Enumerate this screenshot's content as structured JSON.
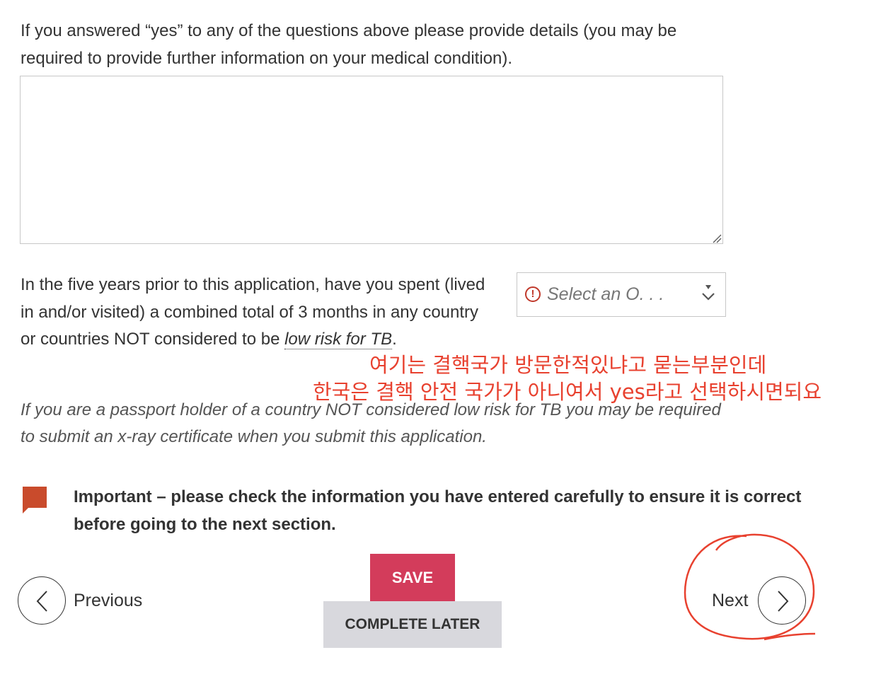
{
  "question_details": {
    "text": "If you answered “yes” to any of the questions above please provide details (you may be required to provide further information on your medical condition).",
    "value": ""
  },
  "question_tb": {
    "text_before": "In the five years prior to this application, have you spent (lived in and/or visited) a combined total of 3 months in any country or countries NOT considered to be ",
    "term": "low risk for TB",
    "text_after": ".",
    "select_placeholder": "Select an O. . .",
    "warning_icon": "!",
    "note": "If you are a passport holder of a country NOT considered low risk for TB you may be required to submit an x-ray certificate when you submit this application."
  },
  "annotation": {
    "line1": "여기는 결핵국가 방문한적있냐고 묻는부분인데",
    "line2": "한국은 결핵 안전 국가가 아니여서 yes라고 선택하시면되요",
    "color": "#e8412f"
  },
  "important": {
    "text": "Important – please check the information you have entered carefully to ensure it is correct before going to the next section.",
    "flag_color": "#c94b2c"
  },
  "nav": {
    "previous_label": "Previous",
    "next_label": "Next",
    "save_label": "SAVE",
    "complete_later_label": "COMPLETE LATER"
  },
  "colors": {
    "save_bg": "#d33c5b",
    "complete_later_bg": "#d8d8dd",
    "text": "#333333"
  }
}
